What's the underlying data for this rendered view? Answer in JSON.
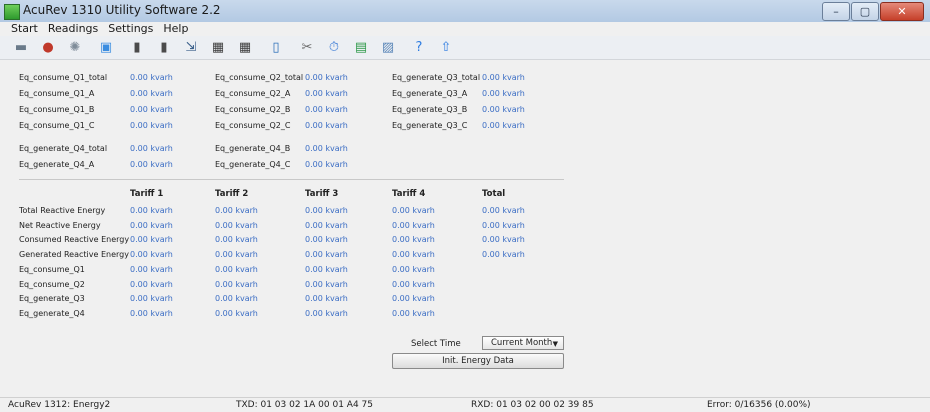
{
  "window": {
    "title": "AcuRev 1310 Utility Software 2.2"
  },
  "menu": [
    "Start",
    "Readings",
    "Settings",
    "Help"
  ],
  "toolbar": [
    {
      "name": "connect-icon",
      "glyph": "▬",
      "color": "#6a7a8a"
    },
    {
      "name": "disconnect-icon",
      "glyph": "●",
      "color": "#c0392b"
    },
    {
      "name": "settings-wheel-icon",
      "glyph": "✺",
      "color": "#7f8c99"
    },
    {
      "name": "monitor-icon",
      "glyph": "▣",
      "color": "#3b8de0"
    },
    {
      "name": "meter-read-icon",
      "glyph": "▮",
      "color": "#4b4b4b"
    },
    {
      "name": "meter-write-icon",
      "glyph": "▮",
      "color": "#4b4b4b"
    },
    {
      "name": "export-icon",
      "glyph": "⇲",
      "color": "#3a5f8a"
    },
    {
      "name": "table-icon",
      "glyph": "▦",
      "color": "#3d3d3d"
    },
    {
      "name": "calendar-icon",
      "glyph": "▦",
      "color": "#3d3d3d"
    },
    {
      "name": "file-icon",
      "glyph": "▯",
      "color": "#2c6fb8"
    },
    {
      "name": "tools-icon",
      "glyph": "✂",
      "color": "#6b6b6b"
    },
    {
      "name": "timer-icon",
      "glyph": "⏱",
      "color": "#3a7bd5"
    },
    {
      "name": "schedule-icon",
      "glyph": "▤",
      "color": "#2f9a4a"
    },
    {
      "name": "image-icon",
      "glyph": "▨",
      "color": "#5a86b8"
    },
    {
      "name": "help-icon",
      "glyph": "?",
      "color": "#2f7de1"
    },
    {
      "name": "upload-icon",
      "glyph": "⇧",
      "color": "#2f7de1"
    }
  ],
  "top_fields": [
    {
      "label": "Eq_consume_Q1_total",
      "value": "0.00 kvarh"
    },
    {
      "label": "Eq_consume_Q1_A",
      "value": "0.00 kvarh"
    },
    {
      "label": "Eq_consume_Q1_B",
      "value": "0.00 kvarh"
    },
    {
      "label": "Eq_consume_Q1_C",
      "value": "0.00 kvarh"
    },
    {
      "label": "Eq_generate_Q4_total",
      "value": "0.00 kvarh"
    },
    {
      "label": "Eq_generate_Q4_A",
      "value": "0.00 kvarh"
    },
    {
      "label": "Eq_consume_Q2_total",
      "value": "0.00 kvarh"
    },
    {
      "label": "Eq_consume_Q2_A",
      "value": "0.00 kvarh"
    },
    {
      "label": "Eq_consume_Q2_B",
      "value": "0.00 kvarh"
    },
    {
      "label": "Eq_consume_Q2_C",
      "value": "0.00 kvarh"
    },
    {
      "label": "Eq_generate_Q4_B",
      "value": "0.00 kvarh"
    },
    {
      "label": "Eq_generate_Q4_C",
      "value": "0.00 kvarh"
    },
    {
      "label": "Eq_generate_Q3_total",
      "value": "0.00 kvarh"
    },
    {
      "label": "Eq_generate_Q3_A",
      "value": "0.00 kvarh"
    },
    {
      "label": "Eq_generate_Q3_B",
      "value": "0.00 kvarh"
    },
    {
      "label": "Eq_generate_Q3_C",
      "value": "0.00 kvarh"
    }
  ],
  "tariff_table": {
    "headers": [
      "Tariff 1",
      "Tariff 2",
      "Tariff 3",
      "Tariff 4",
      "Total"
    ],
    "rows": [
      {
        "label": "Total Reactive Energy",
        "values": [
          "0.00 kvarh",
          "0.00 kvarh",
          "0.00 kvarh",
          "0.00 kvarh",
          "0.00 kvarh"
        ]
      },
      {
        "label": "Net Reactive Energy",
        "values": [
          "0.00 kvarh",
          "0.00 kvarh",
          "0.00 kvarh",
          "0.00 kvarh",
          "0.00 kvarh"
        ]
      },
      {
        "label": "Consumed Reactive Energy",
        "values": [
          "0.00 kvarh",
          "0.00 kvarh",
          "0.00 kvarh",
          "0.00 kvarh",
          "0.00 kvarh"
        ]
      },
      {
        "label": "Generated Reactive Energy",
        "values": [
          "0.00 kvarh",
          "0.00 kvarh",
          "0.00 kvarh",
          "0.00 kvarh",
          "0.00 kvarh"
        ]
      },
      {
        "label": "Eq_consume_Q1",
        "values": [
          "0.00 kvarh",
          "0.00 kvarh",
          "0.00 kvarh",
          "0.00 kvarh"
        ]
      },
      {
        "label": "Eq_consume_Q2",
        "values": [
          "0.00 kvarh",
          "0.00 kvarh",
          "0.00 kvarh",
          "0.00 kvarh"
        ]
      },
      {
        "label": "Eq_generate_Q3",
        "values": [
          "0.00 kvarh",
          "0.00 kvarh",
          "0.00 kvarh",
          "0.00 kvarh"
        ]
      },
      {
        "label": "Eq_generate_Q4",
        "values": [
          "0.00 kvarh",
          "0.00 kvarh",
          "0.00 kvarh",
          "0.00 kvarh"
        ]
      }
    ]
  },
  "controls": {
    "select_time_label": "Select Time",
    "select_time_value": "Current Month",
    "init_button": "Init. Energy Data"
  },
  "status": {
    "device": "AcuRev 1312: Energy2",
    "txd": "TXD:  01 03 02 1A 00 01 A4 75",
    "rxd": "RXD:  01 03 02 00 02 39 85",
    "error": "Error:  0/16356  (0.00%)"
  }
}
